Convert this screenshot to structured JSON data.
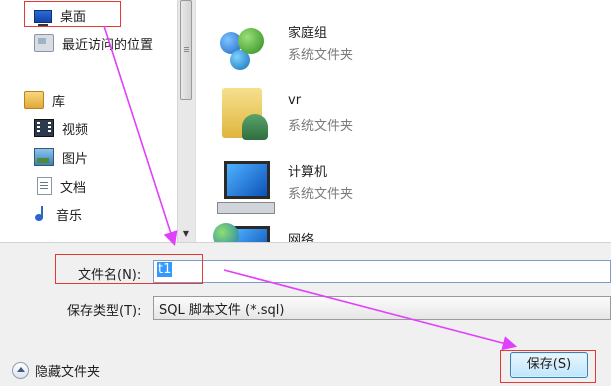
{
  "nav": {
    "items": [
      {
        "label": "桌面",
        "icon": "desktop-icon"
      },
      {
        "label": "最近访问的位置",
        "icon": "recent-places-icon"
      },
      {
        "label": "库",
        "icon": "library-icon"
      },
      {
        "label": "视频",
        "icon": "video-icon"
      },
      {
        "label": "图片",
        "icon": "pictures-icon"
      },
      {
        "label": "文档",
        "icon": "documents-icon"
      },
      {
        "label": "音乐",
        "icon": "music-icon"
      }
    ]
  },
  "content": {
    "items": [
      {
        "name": "家庭组",
        "type": "系统文件夹",
        "icon": "homegroup-icon"
      },
      {
        "name": "vr",
        "type": "系统文件夹",
        "icon": "user-folder-icon"
      },
      {
        "name": "计算机",
        "type": "系统文件夹",
        "icon": "computer-icon"
      },
      {
        "name": "网络",
        "type": "",
        "icon": "network-icon"
      }
    ]
  },
  "form": {
    "filename_label": "文件名(N):",
    "filename_value": "t1",
    "filetype_label": "保存类型(T):",
    "filetype_value": "SQL 脚本文件 (*.sql)"
  },
  "footer": {
    "hide_folders_label": "隐藏文件夹",
    "save_label": "保存(S)"
  },
  "colors": {
    "annotation": "#e53935",
    "arrow": "#e040fb",
    "selection": "#3399ff"
  }
}
